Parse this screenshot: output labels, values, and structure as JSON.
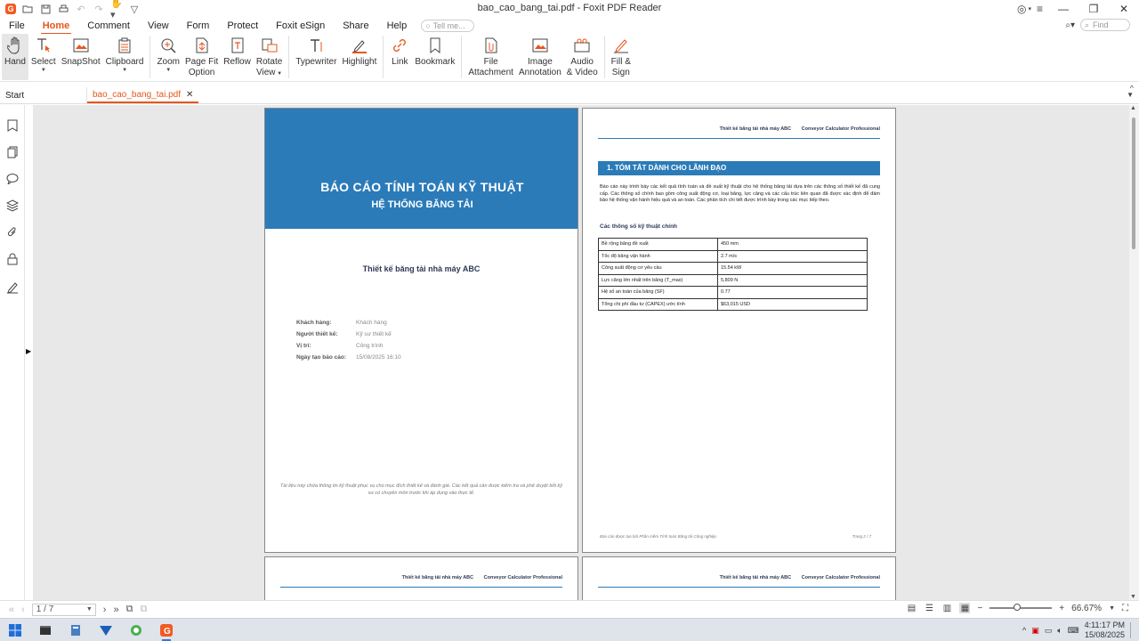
{
  "window": {
    "title": "bao_cao_bang_tai.pdf - Foxit PDF Reader"
  },
  "menu": {
    "items": [
      "File",
      "Home",
      "Comment",
      "View",
      "Form",
      "Protect",
      "Foxit eSign",
      "Share",
      "Help"
    ],
    "active": "Home",
    "tell_me_placeholder": "Tell me...",
    "find_placeholder": "Find"
  },
  "ribbon": {
    "hand": "Hand",
    "select": "Select",
    "snapshot": "SnapShot",
    "clipboard": "Clipboard",
    "zoom": "Zoom",
    "page_fit_1": "Page Fit",
    "page_fit_2": "Option",
    "reflow": "Reflow",
    "rotate_1": "Rotate",
    "rotate_2": "View",
    "typewriter": "Typewriter",
    "highlight": "Highlight",
    "link": "Link",
    "bookmark": "Bookmark",
    "file_attachment_1": "File",
    "file_attachment_2": "Attachment",
    "image_annotation_1": "Image",
    "image_annotation_2": "Annotation",
    "audio_video_1": "Audio",
    "audio_video_2": "& Video",
    "fill_sign_1": "Fill &",
    "fill_sign_2": "Sign"
  },
  "tabs": {
    "start": "Start",
    "doc": "bao_cao_bang_tai.pdf"
  },
  "page1": {
    "title": "BÁO CÁO TÍNH TOÁN KỸ THUẬT",
    "subtitle": "HỆ THỐNG BĂNG TẢI",
    "project": "Thiết kế băng tải nhà máy ABC",
    "info": [
      {
        "k": "Khách hàng:",
        "v": "Khách hàng"
      },
      {
        "k": "Người thiết kế:",
        "v": "Kỹ sư thiết kế"
      },
      {
        "k": "Vị trí:",
        "v": "Công trình"
      },
      {
        "k": "Ngày tạo báo cáo:",
        "v": "15/08/2025 16:10"
      }
    ],
    "footer": "Tài liệu này chứa thông tin kỹ thuật phục vụ cho mục đích thiết kế và đánh giá. Các kết quả cần được kiểm tra và phê duyệt bởi kỹ sư có chuyên môn trước khi áp dụng vào thực tế."
  },
  "header": {
    "project": "Thiết kế băng tải nhà máy ABC",
    "app": "Conveyor Calculator Professional"
  },
  "page2": {
    "section": "1. TÓM TẮT DÀNH CHO LÃNH ĐẠO",
    "paragraph": "Báo cáo này trình bày các kết quả tính toán và đề xuất kỹ thuật cho hệ thống băng tải dựa trên các thông số thiết kế đã cung cấp. Các thông số chính bao gồm công suất động cơ, loại băng, lực căng và các cấu trúc liên quan đã được xác định để đảm bảo hệ thống vận hành hiệu quả và an toàn. Các phân tích chi tiết được trình bày trong các mục tiếp theo.",
    "spec_title": "Các thông số kỹ thuật chính",
    "spec": [
      {
        "k": "Bề rộng băng đề xuất",
        "v": "450 mm"
      },
      {
        "k": "Tốc độ băng vận hành",
        "v": "2.7 m/s"
      },
      {
        "k": "Công suất động cơ yêu cầu",
        "v": "15.54 kW"
      },
      {
        "k": "Lực căng lớn nhất trên băng (T_max)",
        "v": "5,809 N"
      },
      {
        "k": "Hệ số an toàn của băng (SF)",
        "v": "0.77"
      },
      {
        "k": "Tổng chi phí đầu tư (CAPEX) ước tính",
        "v": "$63,015 USD"
      }
    ],
    "footer_left": "Báo cáo được tạo bởi Phần mềm Tính toán Băng tải Công nghiệp",
    "footer_right": "Trang 2 / 7"
  },
  "status": {
    "page_indicator": "1 / 7",
    "zoom": "66.67%"
  },
  "taskbar": {
    "time": "4:11:17 PM",
    "date": "15/08/2025"
  }
}
